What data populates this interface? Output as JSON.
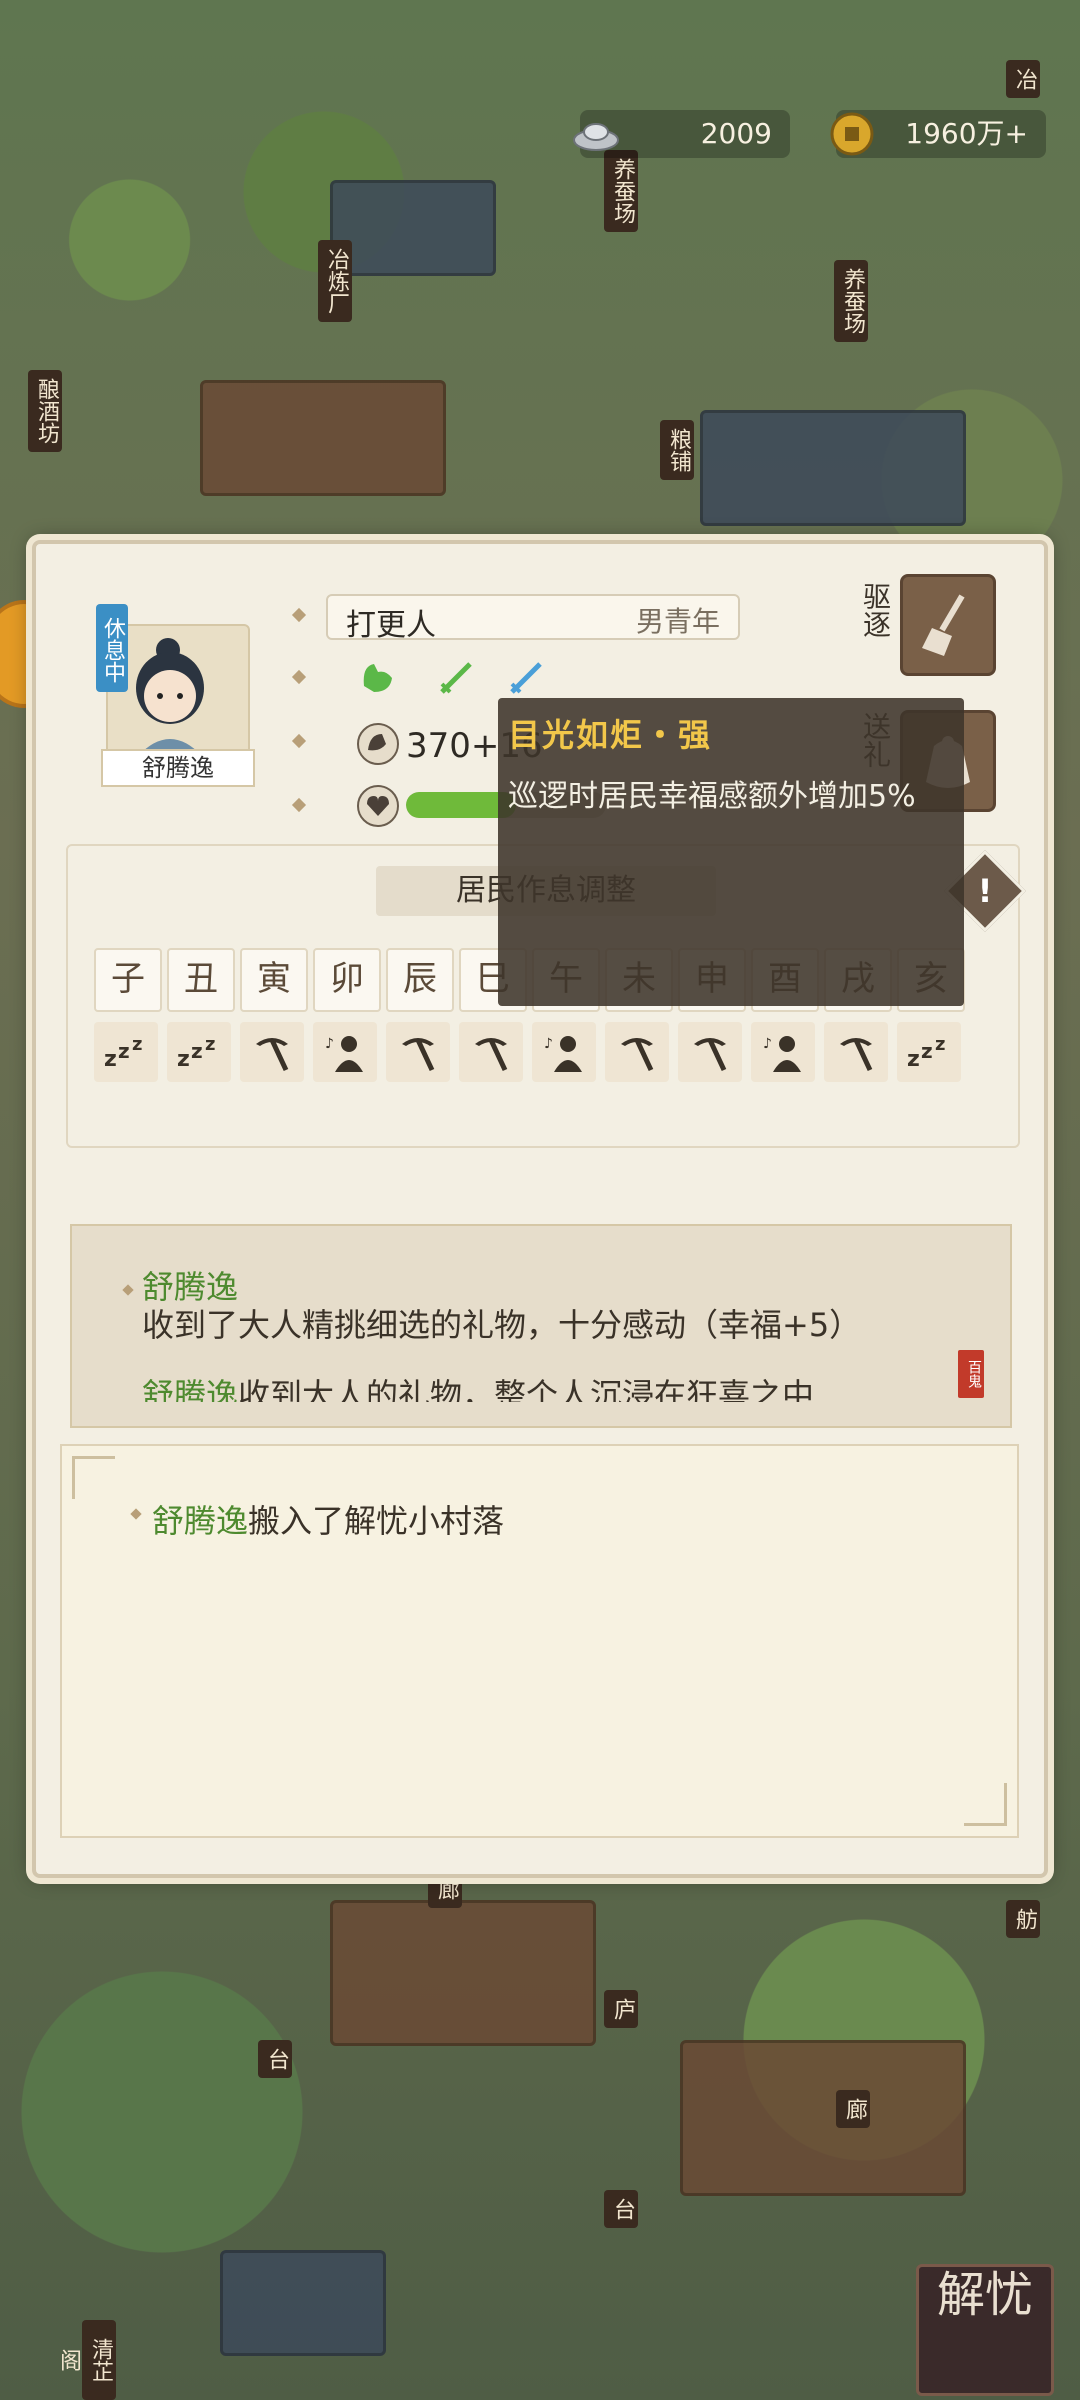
{
  "currency": {
    "silver": "2009",
    "coins": "1960万+"
  },
  "map_signs": [
    "养蚕场",
    "冶炼厂",
    "粮铺",
    "酿酒坊",
    "养蚕场",
    "冶",
    "廊",
    "庐",
    "台",
    "台",
    "廊",
    "舫",
    "清芷阁"
  ],
  "resident": {
    "status_badge": "休息中",
    "name": "舒腾逸",
    "job": "打更人",
    "info": "男青年",
    "stat_value": "370+16",
    "happiness_fraction": 0.55
  },
  "actions": {
    "expel_label": "驱逐",
    "gift_label": "送礼"
  },
  "schedule": {
    "title": "居民作息调整",
    "hours": [
      "子",
      "丑",
      "寅",
      "卯",
      "辰",
      "巳",
      "午",
      "未",
      "申",
      "酉",
      "戌",
      "亥"
    ],
    "activities": [
      "sleep",
      "sleep",
      "work",
      "rest",
      "work",
      "work",
      "rest",
      "work",
      "work",
      "rest",
      "work",
      "sleep"
    ]
  },
  "log": {
    "line1_name": "舒腾逸",
    "line1_text": "收到了大人精挑细选的礼物，十分感动（幸福+5）",
    "line2_name": "舒腾逸",
    "line2_text": "收到大人的礼物，整个人沉浸在狂喜之中",
    "stamp": "百鬼"
  },
  "events": {
    "line1_name": "舒腾逸",
    "line1_text": "搬入了解忧小村落"
  },
  "tooltip": {
    "title": "目光如炬・强",
    "desc": "巡逻时居民幸福感额外增加5%"
  },
  "corner_button": "解忧",
  "colors": {
    "accent_green": "#6fba3a",
    "highlight_name": "#4e8a2f",
    "tooltip_title": "#f2c74a"
  }
}
